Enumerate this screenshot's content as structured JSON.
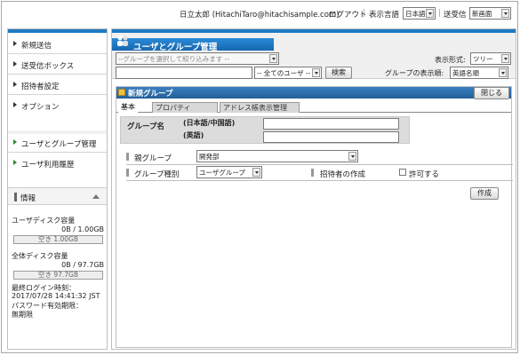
{
  "header": {
    "user_label": "日立太郎 (HitachiTaro@hitachisample.com)",
    "logout": "ログアウト",
    "display_lang_label": "表示言語",
    "display_lang_value": "日本語",
    "receive_label": "送受信",
    "receive_value": "新画面"
  },
  "sidebar": {
    "items": [
      {
        "label": "新規送信"
      },
      {
        "label": "送受信ボックス"
      },
      {
        "label": "招待者設定"
      },
      {
        "label": "オプション"
      },
      {
        "label": "ユーザとグループ管理"
      },
      {
        "label": "ユーザ利用履歴"
      }
    ],
    "info_title": "情報",
    "user_disk_label": "ユーザディスク容量",
    "user_disk_value": "0B / 1.00GB",
    "user_disk_free": "空き 1.00GB",
    "total_disk_label": "全体ディスク容量",
    "total_disk_value": "0B / 97.7GB",
    "total_disk_free": "空き 97.7GB",
    "last_login_label": "最終ログイン時刻：",
    "last_login_value": "2017/07/28 14:41:32 JST",
    "password_label": "パスワード有効期限：",
    "password_value": "無期限"
  },
  "main": {
    "title": "ユーザとグループ管理",
    "group_filter_placeholder": "--グループを選択して絞り込みます --",
    "user_filter": "-- 全てのユーザ --",
    "search_button": "検索",
    "display_format_label": "表示形式:",
    "display_format_value": "ツリー",
    "group_order_label": "グループの表示順:",
    "group_order_value": "英語名順"
  },
  "new_group": {
    "title": "新規グループ",
    "close_button": "閉じる",
    "tabs": [
      "基本",
      "プロパティ",
      "アドレス帳表示管理"
    ],
    "group_name_label": "グループ名",
    "lang_ja_label": "(日本語/中国語)",
    "lang_en_label": "(英語)",
    "parent_group_label": "親グループ",
    "parent_group_value": "開発部",
    "group_type_label": "グループ種別",
    "group_type_value": "ユーザグループ",
    "inviter_label": "招待者の作成",
    "allow_label": "許可する",
    "create_button": "作成"
  }
}
